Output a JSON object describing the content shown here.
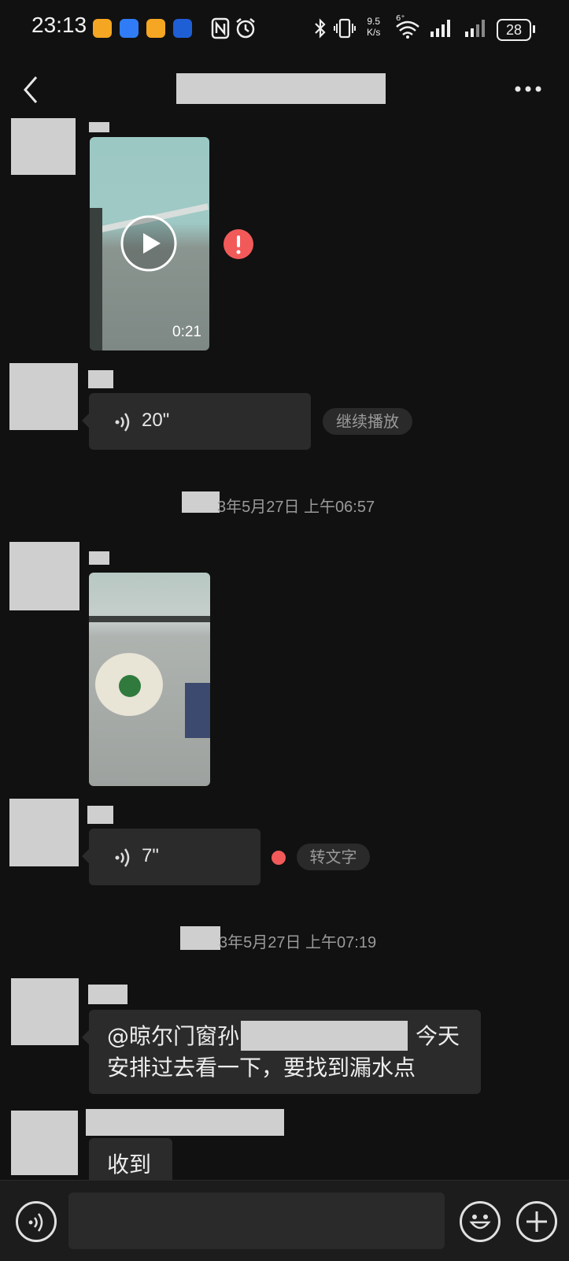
{
  "status_bar": {
    "time": "23:13",
    "net_speed_top": "9.5",
    "net_speed_bottom": "K/s",
    "wifi_label": "6⁺",
    "battery": "28"
  },
  "messages": [
    {
      "type": "video",
      "duration": "0:21",
      "failed": true
    },
    {
      "type": "voice",
      "duration": "20\"",
      "action": "继续播放"
    },
    {
      "type": "timestamp",
      "text": "3年5月27日 上午06:57"
    },
    {
      "type": "video"
    },
    {
      "type": "voice",
      "duration": "7\"",
      "action": "转文字",
      "unread": true
    },
    {
      "type": "timestamp",
      "text": "3年5月27日 上午07:19"
    },
    {
      "type": "text",
      "line1_start": "@晾尔门窗孙",
      "line1_end": "今天",
      "line2": "安排过去看一下，要找到漏水点"
    },
    {
      "type": "text",
      "text": "收到"
    }
  ],
  "colors": {
    "background": "#111111",
    "bubble": "#2b2b2b",
    "error_red": "#f25a5a",
    "chip_bg": "#2a2a2a"
  },
  "icons": [
    "back-arrow-icon",
    "more-dots-icon",
    "play-icon",
    "error-icon",
    "voice-wave-icon",
    "voice-mode-icon",
    "emoji-icon",
    "plus-icon",
    "nfc-icon",
    "alarm-icon",
    "bluetooth-icon",
    "vibrate-icon",
    "wifi-icon",
    "signal-icon",
    "battery-icon"
  ]
}
